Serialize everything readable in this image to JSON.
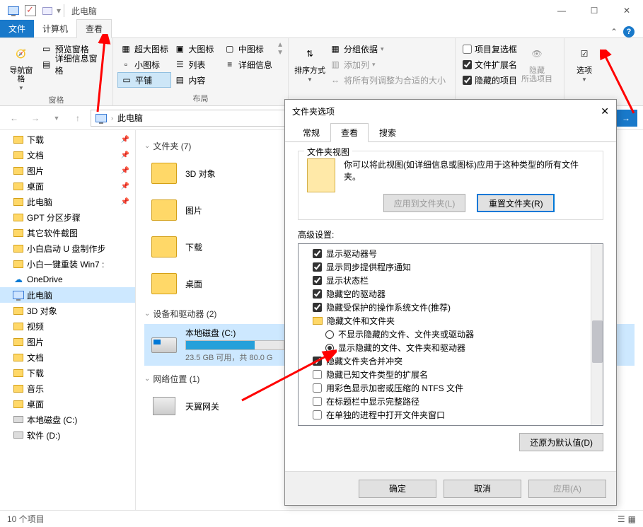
{
  "titlebar": {
    "title": "此电脑"
  },
  "winbtns": {
    "min": "—",
    "max": "☐",
    "close": "✕"
  },
  "tabs": {
    "file": "文件",
    "computer": "计算机",
    "view": "查看"
  },
  "ribbon": {
    "g1": {
      "nav": "导航窗格",
      "preview": "预览窗格",
      "details": "详细信息窗格",
      "label": "窗格"
    },
    "g2": {
      "xlarge": "超大图标",
      "large": "大图标",
      "medium": "中图标",
      "small": "小图标",
      "list": "列表",
      "details": "详细信息",
      "tiles": "平铺",
      "content": "内容",
      "label": "布局"
    },
    "g3": {
      "sort": "排序方式",
      "groupby": "分组依据",
      "addcol": "添加列",
      "sizeall": "将所有列调整为合适的大小"
    },
    "g4": {
      "itemcheck": "项目复选框",
      "ext": "文件扩展名",
      "hidden": "隐藏的项目",
      "hidebtn": "隐藏\n所选项目"
    },
    "g5": {
      "options": "选项"
    }
  },
  "addr": {
    "location": "此电脑"
  },
  "sidebar": {
    "items": [
      {
        "label": "下载",
        "pin": true
      },
      {
        "label": "文档",
        "pin": true
      },
      {
        "label": "图片",
        "pin": true
      },
      {
        "label": "桌面",
        "pin": true
      },
      {
        "label": "此电脑",
        "pin": true
      },
      {
        "label": "GPT 分区步骤"
      },
      {
        "label": "其它软件截图"
      },
      {
        "label": "小白启动 U 盘制作步"
      },
      {
        "label": "小白一键重装 Win7 :"
      },
      {
        "label": "OneDrive",
        "cloud": true
      },
      {
        "label": "此电脑",
        "pc": true,
        "selected": true
      },
      {
        "label": "3D 对象"
      },
      {
        "label": "视频"
      },
      {
        "label": "图片"
      },
      {
        "label": "文档"
      },
      {
        "label": "下载"
      },
      {
        "label": "音乐"
      },
      {
        "label": "桌面"
      },
      {
        "label": "本地磁盘 (C:)",
        "disk": true
      },
      {
        "label": "软件 (D:)",
        "disk": true
      }
    ]
  },
  "content": {
    "g1": {
      "title": "文件夹 (7)",
      "items": [
        "3D 对象",
        "图片",
        "下载",
        "桌面"
      ]
    },
    "g2": {
      "title": "设备和驱动器 (2)",
      "drive_name": "本地磁盘 (C:)",
      "drive_sub": "23.5 GB 可用，共 80.0 G"
    },
    "g3": {
      "title": "网络位置 (1)",
      "item": "天翼网关"
    }
  },
  "statusbar": {
    "count": "10 个项目"
  },
  "dialog": {
    "title": "文件夹选项",
    "tabs": {
      "general": "常规",
      "view": "查看",
      "search": "搜索"
    },
    "folderview": {
      "legend": "文件夹视图",
      "desc": "你可以将此视图(如详细信息或图标)应用于这种类型的所有文件夹。",
      "apply": "应用到文件夹(L)",
      "reset": "重置文件夹(R)"
    },
    "advlabel": "高级设置:",
    "adv": [
      {
        "type": "check",
        "checked": true,
        "label": "显示驱动器号"
      },
      {
        "type": "check",
        "checked": true,
        "label": "显示同步提供程序通知"
      },
      {
        "type": "check",
        "checked": true,
        "label": "显示状态栏"
      },
      {
        "type": "check",
        "checked": true,
        "label": "隐藏空的驱动器"
      },
      {
        "type": "check",
        "checked": true,
        "label": "隐藏受保护的操作系统文件(推荐)"
      },
      {
        "type": "folder",
        "label": "隐藏文件和文件夹"
      },
      {
        "type": "radio",
        "checked": false,
        "label": "不显示隐藏的文件、文件夹或驱动器"
      },
      {
        "type": "radio",
        "checked": true,
        "label": "显示隐藏的文件、文件夹和驱动器"
      },
      {
        "type": "check",
        "checked": true,
        "label": "隐藏文件夹合并冲突"
      },
      {
        "type": "check",
        "checked": false,
        "label": "隐藏已知文件类型的扩展名"
      },
      {
        "type": "check",
        "checked": false,
        "label": "用彩色显示加密或压缩的 NTFS 文件"
      },
      {
        "type": "check",
        "checked": false,
        "label": "在标题栏中显示完整路径"
      },
      {
        "type": "check",
        "checked": false,
        "label": "在单独的进程中打开文件夹窗口"
      }
    ],
    "restore": "还原为默认值(D)",
    "ok": "确定",
    "cancel": "取消",
    "apply": "应用(A)"
  }
}
